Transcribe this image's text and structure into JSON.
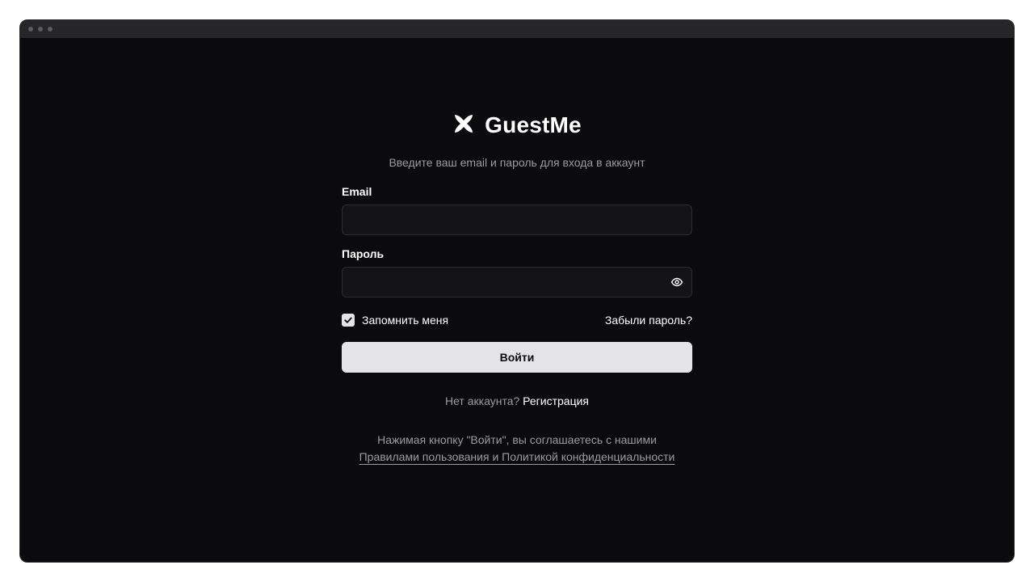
{
  "brand": {
    "name": "GuestMe",
    "logo_icon": "x-logo-icon"
  },
  "subtitle": "Введите ваш email и пароль для входа в аккаунт",
  "form": {
    "email_label": "Email",
    "email_value": "",
    "email_placeholder": "",
    "password_label": "Пароль",
    "password_value": "",
    "password_placeholder": "",
    "remember_label": "Запомнить меня",
    "remember_checked": true,
    "forgot_label": "Забыли пароль?",
    "submit_label": "Войти"
  },
  "signup": {
    "question": "Нет аккаунта?",
    "link": "Регистрация"
  },
  "terms": {
    "text": "Нажимая кнопку \"Войти\", вы соглашаетесь с нашими",
    "link": "Правилами пользования и Политикой конфиденциальности"
  },
  "colors": {
    "background": "#0b0b0d",
    "button": "#e4e4e7",
    "muted_text": "#9b9ba1"
  }
}
